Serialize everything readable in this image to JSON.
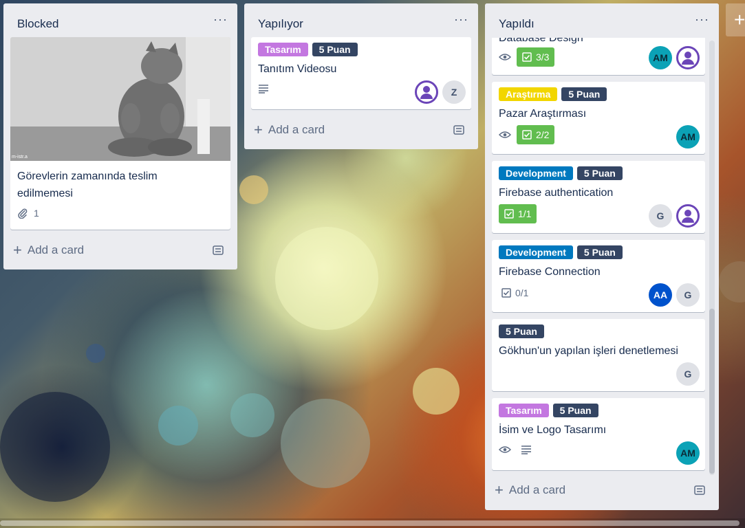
{
  "colors": {
    "tasarim": "#c377e0",
    "puan": "#344563",
    "arastirma": "#f2d600",
    "development": "#0079bf",
    "checklist_done": "#61bd4f"
  },
  "lists": [
    {
      "title": "Blocked",
      "menu": "···",
      "add_card": "Add a card",
      "cards": [
        {
          "image": "cat-photo",
          "image_watermark": "m-istr.a",
          "title": "Görevlerin zamanında teslim edilmemesi",
          "attachments": "1"
        }
      ]
    },
    {
      "title": "Yapılıyor",
      "menu": "···",
      "add_card": "Add a card",
      "cards": [
        {
          "labels": [
            "Tasarım",
            "5 Puan"
          ],
          "title": "Tanıtım Videosu",
          "members": [
            "Z"
          ]
        }
      ]
    },
    {
      "title": "Yapıldı",
      "menu": "···",
      "add_card": "Add a card",
      "cards": [
        {
          "title": "Database Design",
          "checklist": "3/3",
          "members": [
            "AM"
          ]
        },
        {
          "labels": [
            "Araştırma",
            "5 Puan"
          ],
          "title": "Pazar Araştırması",
          "checklist": "2/2",
          "members": [
            "AM"
          ]
        },
        {
          "labels": [
            "Development",
            "5 Puan"
          ],
          "title": "Firebase authentication",
          "checklist": "1/1",
          "members": [
            "G"
          ]
        },
        {
          "labels": [
            "Development",
            "5 Puan"
          ],
          "title": "Firebase Connection",
          "checklist": "0/1",
          "members": [
            "AA",
            "G"
          ]
        },
        {
          "labels": [
            "5 Puan"
          ],
          "title": "Gökhun'un yapılan işleri denetlemesi",
          "members": [
            "G"
          ]
        },
        {
          "labels": [
            "Tasarım",
            "5 Puan"
          ],
          "title": "İsim ve Logo Tasarımı",
          "members": [
            "AM"
          ]
        }
      ]
    }
  ],
  "add_list": "+"
}
